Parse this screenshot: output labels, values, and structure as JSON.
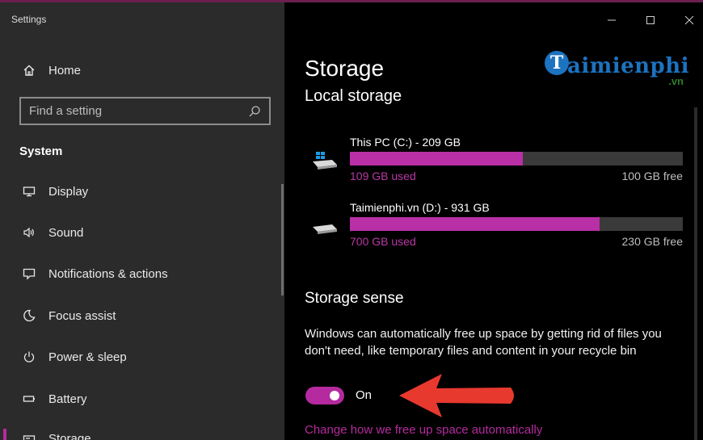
{
  "window": {
    "title": "Settings"
  },
  "sidebar": {
    "home_label": "Home",
    "search_placeholder": "Find a setting",
    "section_label": "System",
    "items": [
      {
        "label": "Display",
        "icon": "monitor-icon"
      },
      {
        "label": "Sound",
        "icon": "speaker-icon"
      },
      {
        "label": "Notifications & actions",
        "icon": "notification-icon"
      },
      {
        "label": "Focus assist",
        "icon": "moon-icon"
      },
      {
        "label": "Power & sleep",
        "icon": "power-icon"
      },
      {
        "label": "Battery",
        "icon": "battery-icon"
      },
      {
        "label": "Storage",
        "icon": "storage-icon",
        "selected": true
      }
    ]
  },
  "main": {
    "title": "Storage",
    "subtitle": "Local storage",
    "logo": {
      "initial": "T",
      "text": "aimienphi",
      "suffix": ".vn"
    },
    "drives": [
      {
        "name": "This PC (C:) - 209 GB",
        "used": "109 GB used",
        "free": "100 GB free",
        "used_fraction": 0.52
      },
      {
        "name": "Taimienphi.vn (D:) - 931 GB",
        "used": "700 GB used",
        "free": "230 GB free",
        "used_fraction": 0.75
      }
    ],
    "storage_sense": {
      "title": "Storage sense",
      "description": "Windows can automatically free up space by getting rid of files you don't need, like temporary files and content in your recycle bin",
      "toggle_label": "On",
      "toggle_on": true,
      "link": "Change how we free up space automatically"
    }
  },
  "colors": {
    "accent": "#b52a9e",
    "sidebar_bg": "#2b2b2b",
    "main_bg": "#000000",
    "logo_blue": "#1c73c0",
    "arrow_red": "#e8392f"
  }
}
